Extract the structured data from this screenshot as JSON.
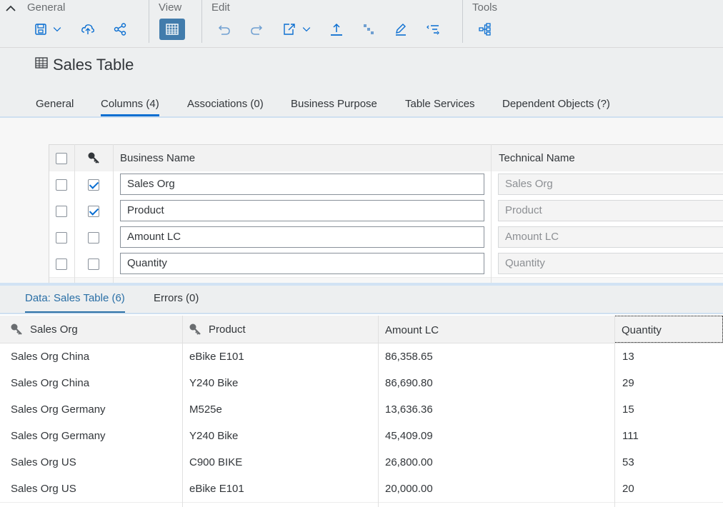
{
  "toolbar": {
    "groups": {
      "general": "General",
      "view": "View",
      "edit": "Edit",
      "tools": "Tools"
    }
  },
  "page": {
    "title": "Sales Table"
  },
  "tabs": [
    {
      "label": "General"
    },
    {
      "label": "Columns (4)"
    },
    {
      "label": "Associations (0)"
    },
    {
      "label": "Business Purpose"
    },
    {
      "label": "Table Services"
    },
    {
      "label": "Dependent Objects (?)"
    }
  ],
  "columns_table": {
    "headers": {
      "business_name": "Business Name",
      "technical_name": "Technical Name"
    },
    "rows": [
      {
        "key": true,
        "business": "Sales Org",
        "technical": "Sales Org"
      },
      {
        "key": true,
        "business": "Product",
        "technical": "Product"
      },
      {
        "key": false,
        "business": "Amount LC",
        "technical": "Amount LC"
      },
      {
        "key": false,
        "business": "Quantity",
        "technical": "Quantity"
      }
    ]
  },
  "data_panel": {
    "tabs": [
      {
        "label": "Data: Sales Table (6)"
      },
      {
        "label": "Errors (0)"
      }
    ],
    "headers": [
      "Sales Org",
      "Product",
      "Amount LC",
      "Quantity"
    ],
    "rows": [
      [
        "Sales Org China",
        "eBike E101",
        "86,358.65",
        "13"
      ],
      [
        "Sales Org China",
        "Y240 Bike",
        "86,690.80",
        "29"
      ],
      [
        "Sales Org Germany",
        "M525e",
        "13,636.36",
        "15"
      ],
      [
        "Sales Org Germany",
        "Y240 Bike",
        "45,409.09",
        "111"
      ],
      [
        "Sales Org US",
        "C900 BIKE",
        "26,800.00",
        "53"
      ],
      [
        "Sales Org US",
        "eBike E101",
        "20,000.00",
        "20"
      ]
    ]
  },
  "colors": {
    "accent": "#0a6ed1",
    "active_button": "#427cac",
    "toolbar_bg": "#edeff0"
  }
}
